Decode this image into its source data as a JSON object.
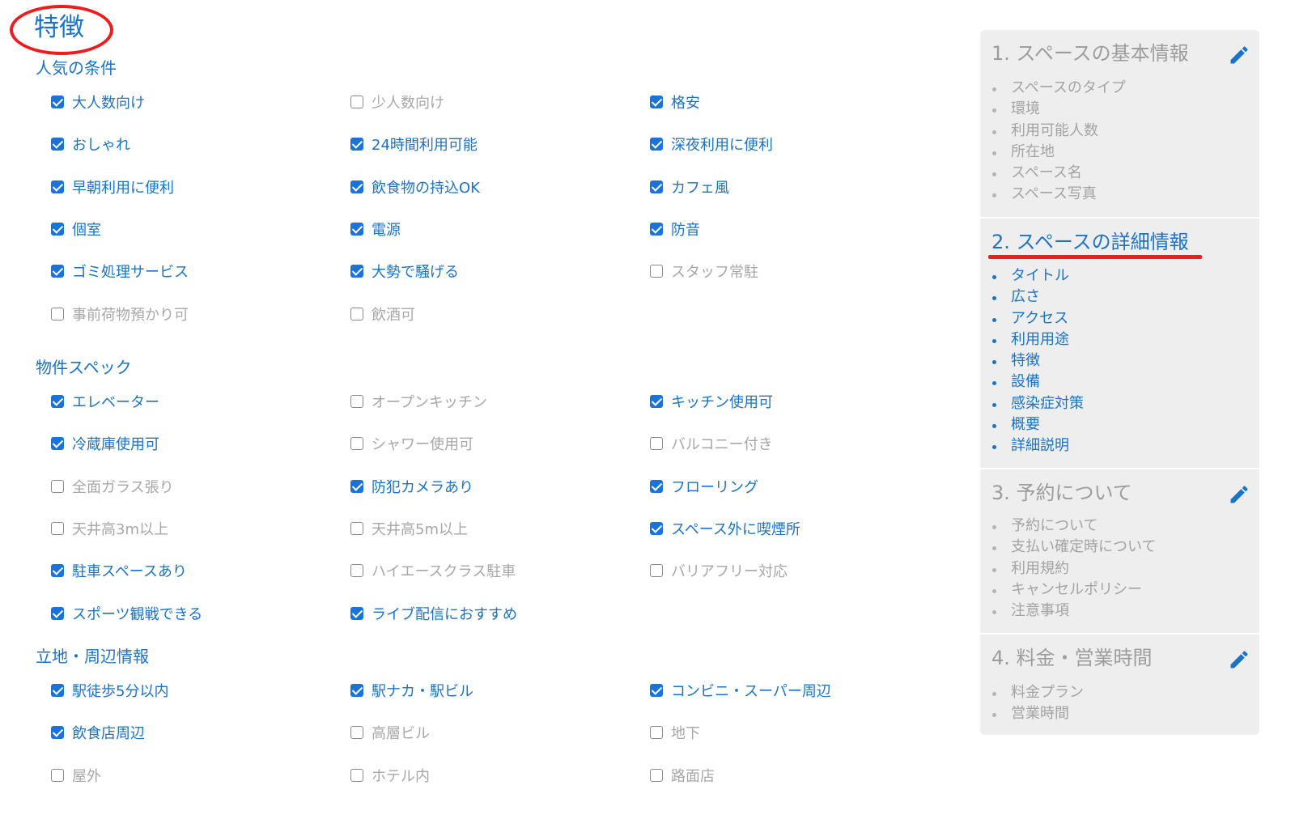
{
  "page": {
    "title": "特徴"
  },
  "sections": [
    {
      "title": "人気の条件",
      "items": [
        {
          "label": "大人数向け",
          "checked": true
        },
        {
          "label": "少人数向け",
          "checked": false
        },
        {
          "label": "格安",
          "checked": true
        },
        {
          "label": "おしゃれ",
          "checked": true
        },
        {
          "label": "24時間利用可能",
          "checked": true
        },
        {
          "label": "深夜利用に便利",
          "checked": true
        },
        {
          "label": "早朝利用に便利",
          "checked": true
        },
        {
          "label": "飲食物の持込OK",
          "checked": true
        },
        {
          "label": "カフェ風",
          "checked": true
        },
        {
          "label": "個室",
          "checked": true
        },
        {
          "label": "電源",
          "checked": true
        },
        {
          "label": "防音",
          "checked": true
        },
        {
          "label": "ゴミ処理サービス",
          "checked": true
        },
        {
          "label": "大勢で騒げる",
          "checked": true
        },
        {
          "label": "スタッフ常駐",
          "checked": false
        },
        {
          "label": "事前荷物預かり可",
          "checked": false
        },
        {
          "label": "飲酒可",
          "checked": false
        }
      ]
    },
    {
      "title": "物件スペック",
      "items": [
        {
          "label": "エレベーター",
          "checked": true
        },
        {
          "label": "オープンキッチン",
          "checked": false
        },
        {
          "label": "キッチン使用可",
          "checked": true
        },
        {
          "label": "冷蔵庫使用可",
          "checked": true
        },
        {
          "label": "シャワー使用可",
          "checked": false
        },
        {
          "label": "バルコニー付き",
          "checked": false
        },
        {
          "label": "全面ガラス張り",
          "checked": false
        },
        {
          "label": "防犯カメラあり",
          "checked": true
        },
        {
          "label": "フローリング",
          "checked": true
        },
        {
          "label": "天井高3m以上",
          "checked": false
        },
        {
          "label": "天井高5m以上",
          "checked": false
        },
        {
          "label": "スペース外に喫煙所",
          "checked": true
        },
        {
          "label": "駐車スペースあり",
          "checked": true
        },
        {
          "label": "ハイエースクラス駐車",
          "checked": false
        },
        {
          "label": "バリアフリー対応",
          "checked": false
        },
        {
          "label": "スポーツ観戦できる",
          "checked": true
        },
        {
          "label": "ライブ配信におすすめ",
          "checked": true
        }
      ]
    },
    {
      "title": "立地・周辺情報",
      "items": [
        {
          "label": "駅徒歩5分以内",
          "checked": true
        },
        {
          "label": "駅ナカ・駅ビル",
          "checked": true
        },
        {
          "label": "コンビニ・スーパー周辺",
          "checked": true
        },
        {
          "label": "飲食店周辺",
          "checked": true
        },
        {
          "label": "高層ビル",
          "checked": false
        },
        {
          "label": "地下",
          "checked": false
        },
        {
          "label": "屋外",
          "checked": false
        },
        {
          "label": "ホテル内",
          "checked": false
        },
        {
          "label": "路面店",
          "checked": false
        }
      ]
    }
  ],
  "sidebar": {
    "steps": [
      {
        "title": "1. スペースの基本情報",
        "active": false,
        "editable": true,
        "items": [
          "スペースのタイプ",
          "環境",
          "利用可能人数",
          "所在地",
          "スペース名",
          "スペース写真"
        ]
      },
      {
        "title": "2. スペースの詳細情報",
        "active": true,
        "editable": false,
        "items": [
          "タイトル",
          "広さ",
          "アクセス",
          "利用用途",
          "特徴",
          "設備",
          "感染症対策",
          "概要",
          "詳細説明"
        ]
      },
      {
        "title": "3. 予約について",
        "active": false,
        "editable": true,
        "items": [
          "予約について",
          "支払い確定時について",
          "利用規約",
          "キャンセルポリシー",
          "注意事項"
        ]
      },
      {
        "title": "4. 料金・営業時間",
        "active": false,
        "editable": true,
        "items": [
          "料金プラン",
          "営業時間"
        ]
      }
    ]
  },
  "colors": {
    "accent": "#1a73c8",
    "checkbox": "#1a73d8",
    "annotation": "#ee1c1c",
    "muted_text": "#a7a7a7",
    "sidebar_bg": "#eeeeee"
  },
  "icons": {
    "edit": "pencil-icon"
  }
}
